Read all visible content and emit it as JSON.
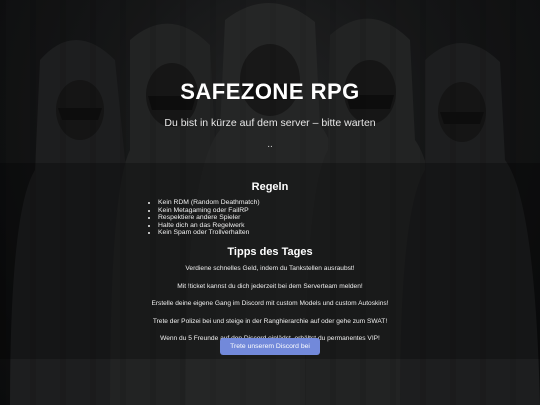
{
  "header": {
    "title": "SAFEZONE RPG",
    "subtitle": "Du bist in kürze auf dem server – bitte warten",
    "loading_indicator": ".."
  },
  "rules": {
    "heading": "Regeln",
    "items": [
      "Kein RDM (Random Deathmatch)",
      "Kein Metagaming oder FailRP",
      "Respektiere andere Spieler",
      "Halte dich an das Regelwerk",
      "Kein Spam oder Trollverhalten"
    ]
  },
  "tips": {
    "heading": "Tipps des Tages",
    "items": [
      "Verdiene schnelles Geld, indem du Tankstellen ausraubst!",
      "Mit !ticket kannst du dich jederzeit bei dem Serverteam melden!",
      "Erstelle deine eigene Gang im Discord mit custom Models und custom Autoskins!",
      "Trete der Polizei bei und steige in der Ranghierarchie auf oder gehe zum SWAT!",
      "Wenn du 5 Freunde auf den Discord einlädst, erhältst du permanentes VIP!"
    ]
  },
  "discord_button": {
    "label": "Trete unserem Discord bei"
  },
  "colors": {
    "background": "#151718",
    "text": "#ffffff",
    "discord_button": "#7289da"
  }
}
